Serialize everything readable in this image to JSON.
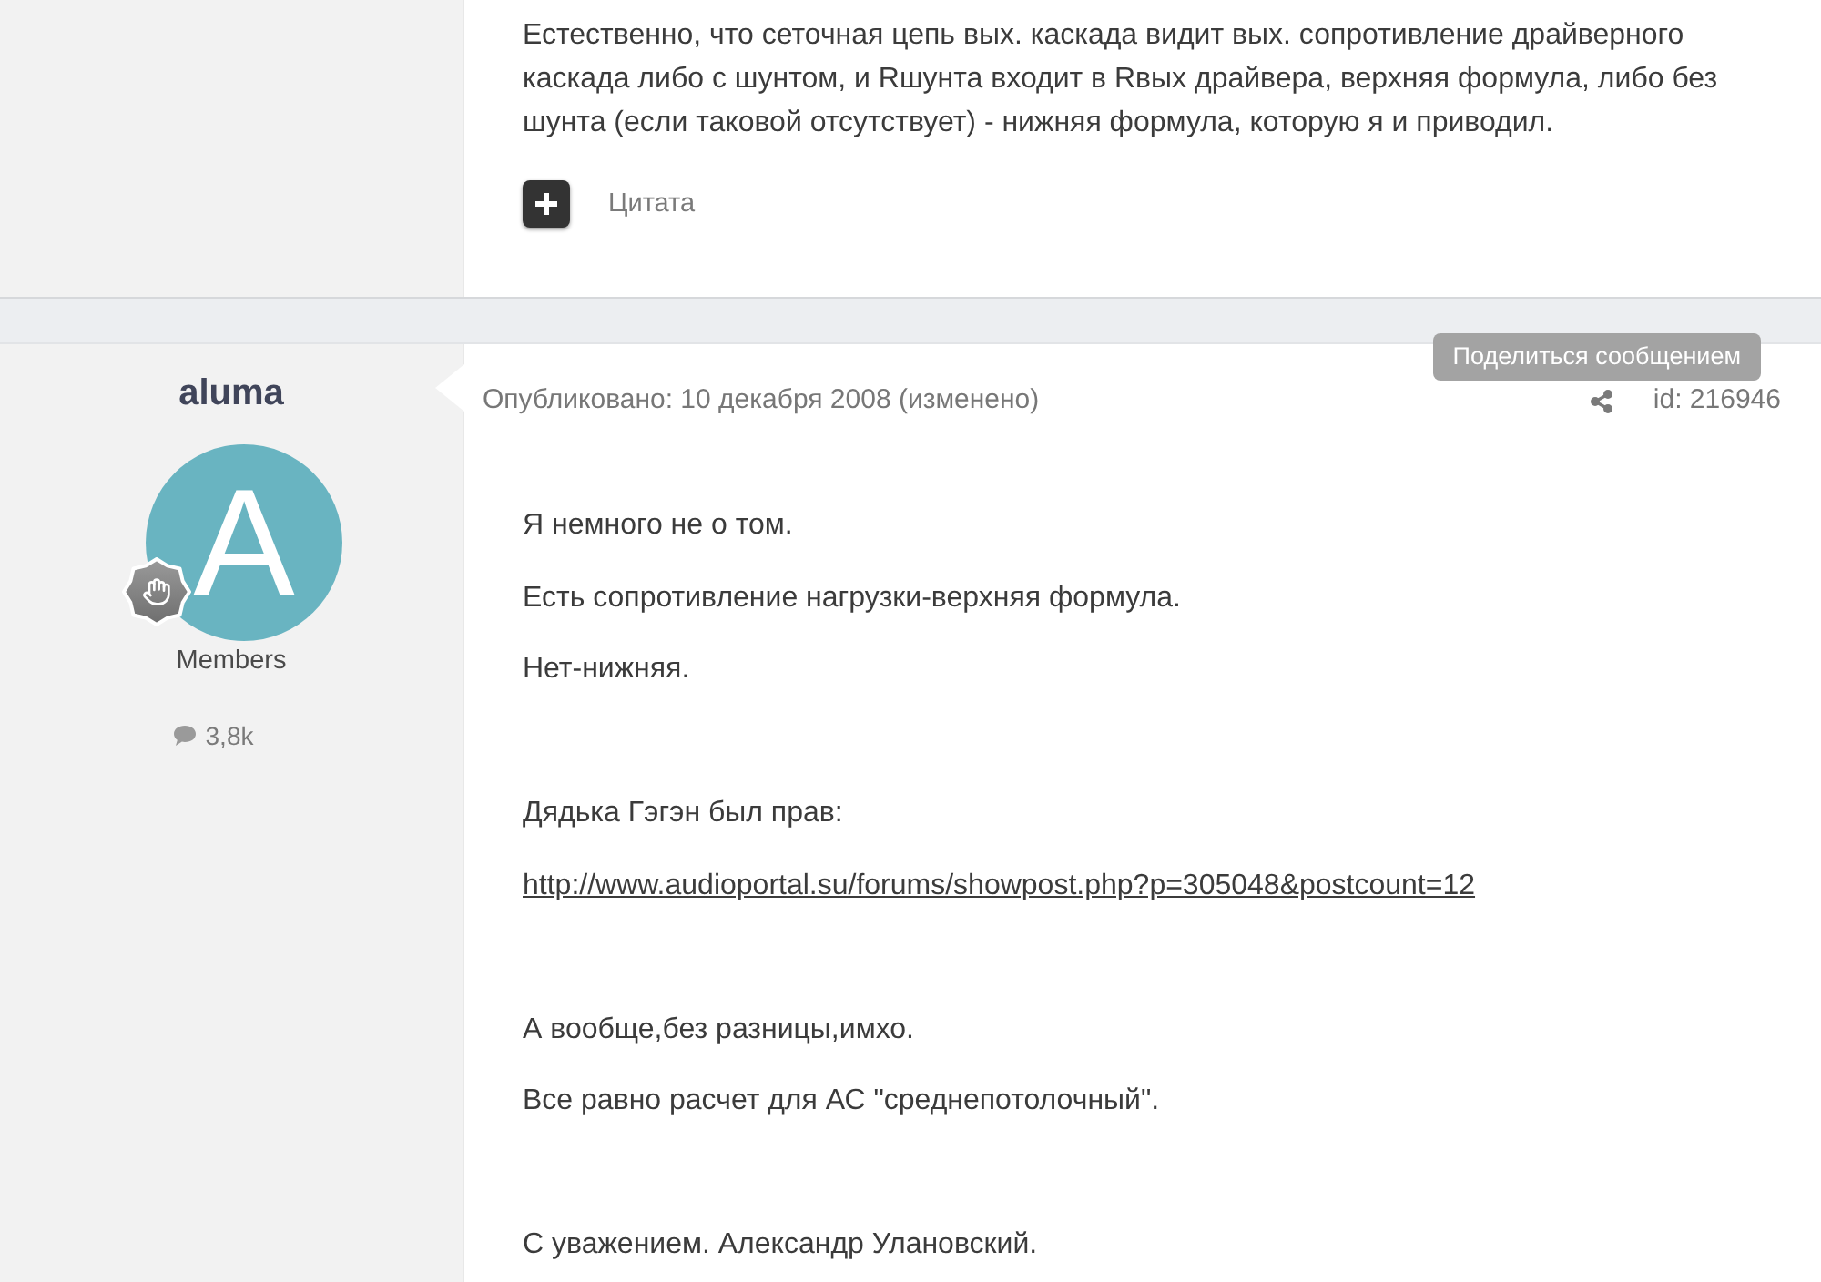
{
  "previous_post": {
    "body": "Естественно, что сеточная цепь вых. каскада видит вых. сопротивление драйверного каскада либо с шунтом, и Rшунта входит в Rвых драйвера, верхняя формула, либо без шунта (если таковой отсутствует) - нижняя формула, которую я и приводил.",
    "quote_link": "Цитата"
  },
  "post": {
    "author": {
      "name": "aluma",
      "avatar_letter": "A",
      "group": "Members",
      "post_count": "3,8k"
    },
    "published": "Опубликовано: 10 декабря 2008 (изменено)",
    "share_tooltip": "Поделиться сообщением",
    "post_id": "id: 216946",
    "blocks": [
      {
        "paragraphs": [
          {
            "kind": "text",
            "text": "Я немного не о том."
          },
          {
            "kind": "text",
            "text": "Есть сопротивление нагрузки-верхняя формула."
          },
          {
            "kind": "text",
            "text": "Нет-нижняя."
          }
        ]
      },
      {
        "paragraphs": [
          {
            "kind": "text",
            "text": "Дядька Гэгэн был прав:"
          },
          {
            "kind": "link",
            "text": "http://www.audioportal.su/forums/showpost.php?p=305048&postcount=12"
          }
        ]
      },
      {
        "paragraphs": [
          {
            "kind": "text",
            "text": "А вообще,без разницы,имхо."
          },
          {
            "kind": "text",
            "text": "Все равно расчет для АС \"среднепотолочный\"."
          }
        ]
      },
      {
        "paragraphs": [
          {
            "kind": "text",
            "text": "С уважением. Александр Улановский."
          }
        ]
      }
    ]
  }
}
